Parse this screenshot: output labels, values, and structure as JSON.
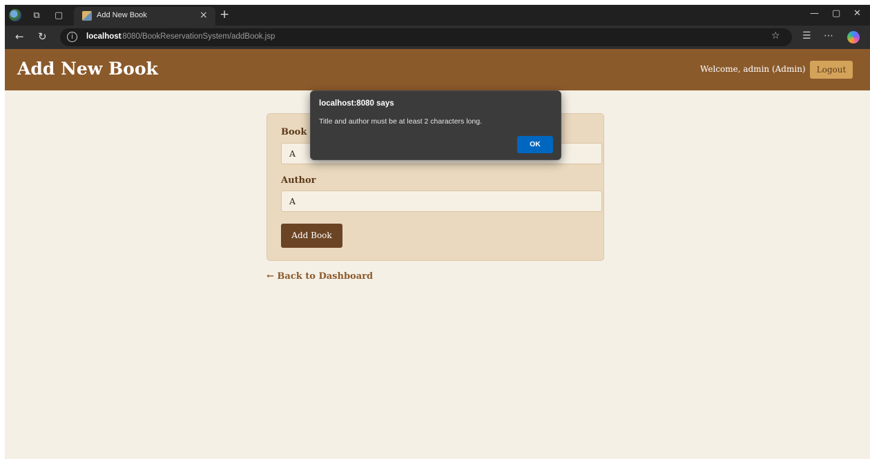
{
  "browser": {
    "tab_title": "Add New Book",
    "tab_close_glyph": "×",
    "new_tab_glyph": "+",
    "url_host": "localhost",
    "url_rest": ":8080/BookReservationSystem/addBook.jsp",
    "icons": [
      "globe-icon",
      "workspaces-icon",
      "tab-actions-icon",
      "back-arrow-icon",
      "reload-icon",
      "info-icon",
      "favorite-star-icon",
      "favorites-list-icon",
      "more-icon",
      "copilot-icon",
      "minimize-icon",
      "maximize-icon",
      "close-icon"
    ]
  },
  "header": {
    "title": "Add New Book",
    "welcome": "Welcome, admin (Admin)",
    "logout_label": "Logout",
    "bg_color": "#8b5a2b"
  },
  "form": {
    "title_label": "Book Title",
    "title_value": "A",
    "author_label": "Author",
    "author_value": "A",
    "submit_label": "Add Book"
  },
  "back_link": "← Back to Dashboard",
  "alert": {
    "title": "localhost:8080 says",
    "message": "Title and author must be at least 2 characters long.",
    "ok_label": "OK",
    "ok_color": "#0067c0"
  }
}
